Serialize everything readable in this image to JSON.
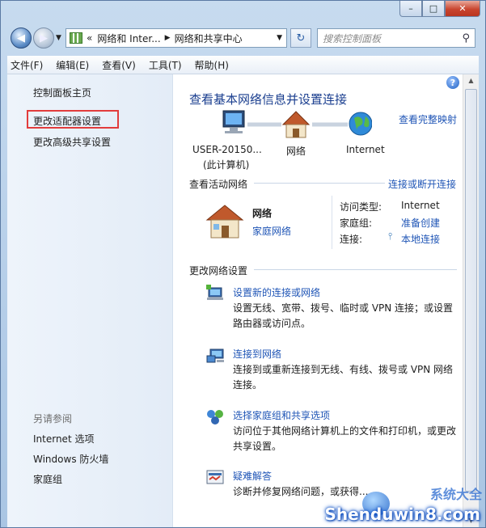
{
  "window": {
    "caption_buttons": {
      "minimize": "–",
      "maximize": "□",
      "close": "✕"
    }
  },
  "navbar": {
    "breadcrumb": [
      "网络和 Inter...",
      "网络和共享中心"
    ],
    "breadcrumb_prefix": "«",
    "search_placeholder": "搜索控制面板"
  },
  "menubar": [
    "文件(F)",
    "编辑(E)",
    "查看(V)",
    "工具(T)",
    "帮助(H)"
  ],
  "leftpane": {
    "links": [
      "控制面板主页",
      "更改适配器设置",
      "更改高级共享设置"
    ],
    "see_also_title": "另请参阅",
    "see_also": [
      "Internet 选项",
      "Windows 防火墙",
      "家庭组"
    ]
  },
  "main": {
    "title": "查看基本网络信息并设置连接",
    "full_map_link": "查看完整映射",
    "map": {
      "computer_name": "USER-20150...",
      "computer_sub": "(此计算机)",
      "network": "网络",
      "internet": "Internet"
    },
    "active_networks_label": "查看活动网络",
    "connect_disconnect_link": "连接或断开连接",
    "active_network": {
      "name": "网络",
      "type_link": "家庭网络",
      "access_type_label": "访问类型:",
      "access_type_value": "Internet",
      "homegroup_label": "家庭组:",
      "homegroup_value": "准备创建",
      "connection_label": "连接:",
      "connection_value": "本地连接"
    },
    "change_settings_label": "更改网络设置",
    "tasks": [
      {
        "icon": "new-connection-icon",
        "title": "设置新的连接或网络",
        "desc": "设置无线、宽带、拨号、临时或 VPN 连接；或设置路由器或访问点。"
      },
      {
        "icon": "connect-network-icon",
        "title": "连接到网络",
        "desc": "连接到或重新连接到无线、有线、拨号或 VPN 网络连接。"
      },
      {
        "icon": "homegroup-sharing-icon",
        "title": "选择家庭组和共享选项",
        "desc": "访问位于其他网络计算机上的文件和打印机，或更改共享设置。"
      },
      {
        "icon": "troubleshoot-icon",
        "title": "疑难解答",
        "desc": "诊断并修复网络问题，或获得..."
      }
    ]
  },
  "watermark": {
    "text": "Shenduwin8.com",
    "cn": "系统大全"
  },
  "colors": {
    "link": "#1f55b6",
    "title": "#1a3e8f",
    "highlight_border": "#e23c3c"
  }
}
